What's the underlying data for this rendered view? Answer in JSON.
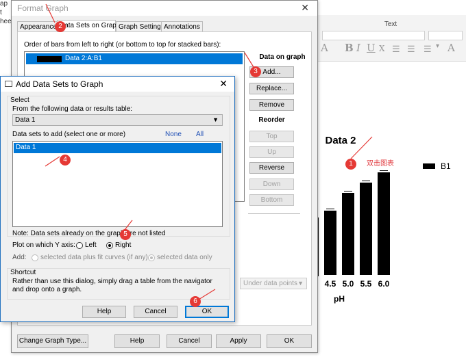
{
  "background": {
    "left_peek": {
      "line1": "ap",
      "line2": "t",
      "line3": "heet"
    },
    "ribbon": {
      "group_label": "Text"
    },
    "format_buttons": [
      "A",
      "B",
      "I",
      "U",
      "X",
      "A"
    ]
  },
  "chart": {
    "title": "Data 2",
    "x_label": "pH",
    "legend_label": "B1",
    "annotation_text": "双击图表",
    "tick_labels": [
      "4.5",
      "5.0",
      "5.5",
      "6.0"
    ]
  },
  "chart_data": {
    "type": "bar",
    "title": "Data 2",
    "xlabel": "pH",
    "ylabel": "",
    "categories": [
      "4.5",
      "5.0",
      "5.5",
      "6.0"
    ],
    "series": [
      {
        "name": "B1",
        "values": [
          0.94,
          1.2,
          1.35,
          1.5
        ]
      }
    ],
    "ylim": [
      0,
      1.6
    ],
    "grid": false,
    "legend_placement": "right",
    "bar_color": "#000000"
  },
  "format_dialog": {
    "title": "Format Graph",
    "tabs": [
      "Appearance",
      "Data Sets on Graph",
      "Graph Settings",
      "Annotations"
    ],
    "order_label": "Order of bars from left to right (or bottom to top for stacked bars):",
    "order_items": [
      {
        "label": "Data 2:A:B1"
      }
    ],
    "data_on_graph_label": "Data on graph",
    "add_label": "Add...",
    "replace_label": "Replace...",
    "remove_label": "Remove",
    "reorder_label": "Reorder",
    "top_label": "Top",
    "up_label": "Up",
    "reverse_label": "Reverse",
    "down_label": "Down",
    "bottom_label": "Bottom",
    "under_dropdown_value": "Under data points",
    "change_type_label": "Change Graph Type...",
    "help_label": "Help",
    "cancel_label": "Cancel",
    "apply_label": "Apply",
    "ok_label": "OK"
  },
  "add_dialog": {
    "title": "Add Data Sets to Graph",
    "select_group_label": "Select",
    "source_label": "From the following data or results table:",
    "source_value": "Data 1",
    "sets_label": "Data sets to add (select one or more)",
    "none_link": "None",
    "all_link": "All",
    "sets": [
      {
        "label": "Data 1"
      }
    ],
    "note": "Note: Data sets already on the graph are not listed",
    "y_axis_label": "Plot on which Y axis:",
    "y_axis_left": "Left",
    "y_axis_right": "Right",
    "add_label": "Add:",
    "add_option_1": "selected data plus fit curves (if any)",
    "add_option_2": "selected data only",
    "shortcut_group_label": "Shortcut",
    "shortcut_text": "Rather than use this dialog, simply drag a table from the navigator and drop onto a graph.",
    "help_label": "Help",
    "cancel_label": "Cancel",
    "ok_label": "OK"
  },
  "annotations": [
    "1",
    "2",
    "3",
    "4",
    "5",
    "6"
  ],
  "colors": {
    "selection": "#0078d7",
    "annotation_red": "#e53935",
    "link_blue": "#1f4fb5"
  }
}
